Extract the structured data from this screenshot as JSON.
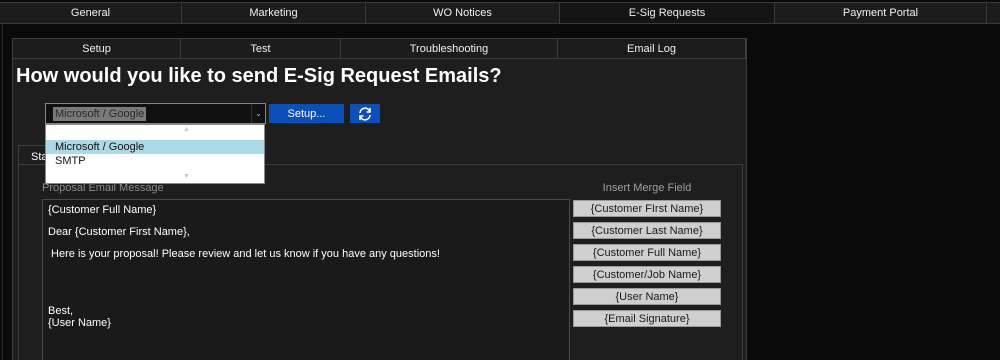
{
  "top_tabs": [
    "General",
    "Marketing",
    "WO Notices",
    "E-Sig Requests",
    "Payment Portal"
  ],
  "sub_tabs": [
    "Setup",
    "Test",
    "Troubleshooting",
    "Email Log"
  ],
  "heading": "How would you like to send E-Sig Request Emails?",
  "send_method": {
    "selected": "Microsoft / Google",
    "options": [
      "Microsoft / Google",
      "SMTP"
    ],
    "arrow_icon": "chevron-down-icon"
  },
  "setup_button": "Setup...",
  "refresh_icon": "refresh-icon",
  "inner_tab_label": "Sta",
  "proposal_label": "Proposal Email Message",
  "message_lines": [
    "{Customer Full Name}",
    "Dear {Customer First Name},",
    " Here is your proposal! Please review and let us know if you have any questions!",
    "Best,",
    "{User Name}"
  ],
  "merge_label": "Insert Merge Field",
  "merge_fields": [
    "{Customer FIrst Name}",
    "{Customer Last Name}",
    "{Customer Full Name}",
    "{Customer/Job Name}",
    "{User Name}",
    "{Email Signature}"
  ],
  "colors": {
    "accent_blue": "#0d4fb8",
    "selected_option": "#add8e6",
    "background": "#0a0a0a",
    "panel": "#1e1e1e"
  }
}
